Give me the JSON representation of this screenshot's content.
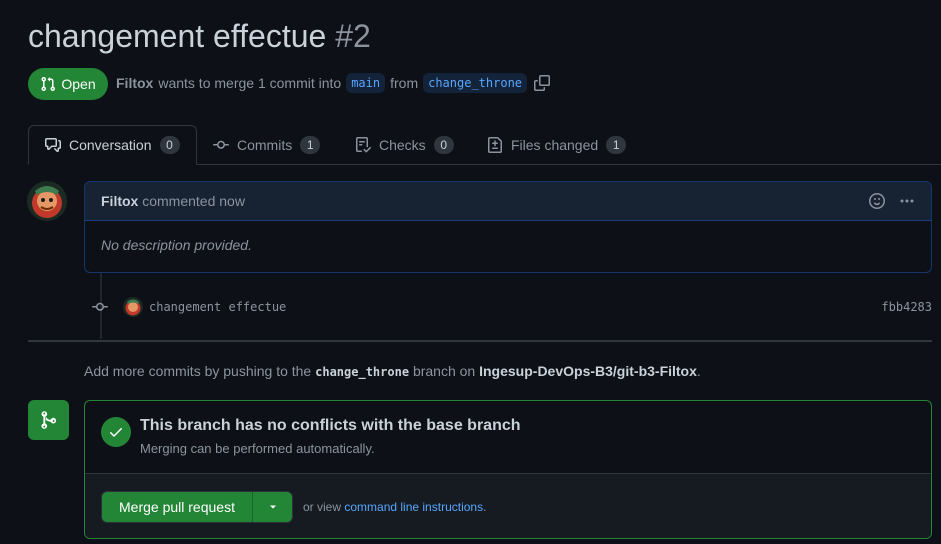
{
  "pr": {
    "title": "changement effectue",
    "number": "#2",
    "state": "Open",
    "author": "Filtox",
    "meta_text": "wants to merge 1 commit into",
    "base_branch": "main",
    "from_text": "from",
    "head_branch": "change_throne"
  },
  "tabs": [
    {
      "label": "Conversation",
      "count": "0",
      "icon": "comment-discussion-icon"
    },
    {
      "label": "Commits",
      "count": "1",
      "icon": "git-commit-icon"
    },
    {
      "label": "Checks",
      "count": "0",
      "icon": "checklist-icon"
    },
    {
      "label": "Files changed",
      "count": "1",
      "icon": "file-diff-icon"
    }
  ],
  "comment": {
    "author": "Filtox",
    "action": "commented now",
    "body": "No description provided."
  },
  "commit": {
    "message": "changement effectue",
    "sha": "fbb4283"
  },
  "hint": {
    "prefix": "Add more commits by pushing to the",
    "branch": "change_throne",
    "middle": "branch on",
    "repo": "Ingesup-DevOps-B3/git-b3-Filtox",
    "suffix": "."
  },
  "merge": {
    "title": "This branch has no conflicts with the base branch",
    "subtitle": "Merging can be performed automatically.",
    "button_label": "Merge pull request",
    "or_view": "or view",
    "instructions_link": "command line instructions",
    "period": "."
  },
  "colors": {
    "background": "#0d1117",
    "success": "#238636",
    "link": "#58a6ff",
    "muted": "#8b949e"
  }
}
